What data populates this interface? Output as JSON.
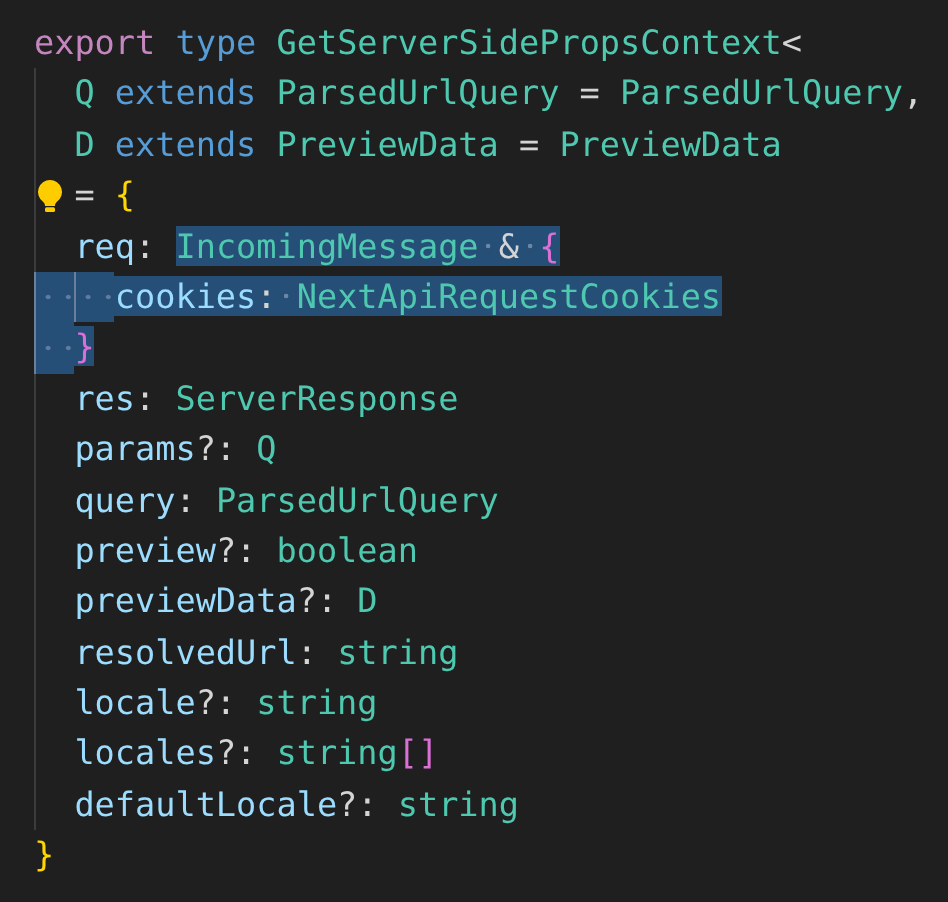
{
  "editor": {
    "lines": [
      {
        "tokens": [
          {
            "text": "export ",
            "kind": "keyword"
          },
          {
            "text": "type ",
            "kind": "storage"
          },
          {
            "text": "GetServerSidePropsContext",
            "kind": "type"
          },
          {
            "text": "<",
            "kind": "punct"
          }
        ],
        "children": [
          {
            "tokens": [
              {
                "text": "Q ",
                "kind": "type"
              },
              {
                "text": "extends ",
                "kind": "storage"
              },
              {
                "text": "ParsedUrlQuery",
                "kind": "type"
              },
              {
                "text": " = ",
                "kind": "punct"
              },
              {
                "text": "ParsedUrlQuery",
                "kind": "type"
              },
              {
                "text": ",",
                "kind": "punct"
              }
            ]
          },
          {
            "tokens": [
              {
                "text": "D ",
                "kind": "type"
              },
              {
                "text": "extends ",
                "kind": "storage"
              },
              {
                "text": "PreviewData",
                "kind": "type"
              },
              {
                "text": " = ",
                "kind": "punct"
              },
              {
                "text": "PreviewData",
                "kind": "type"
              }
            ]
          },
          {
            "lightbulb": true,
            "tokens": [
              {
                "text": "= ",
                "kind": "punct"
              },
              {
                "text": "{",
                "kind": "bracket1"
              }
            ]
          },
          {
            "tokens": [
              {
                "text": "req",
                "kind": "property"
              },
              {
                "text": ": ",
                "kind": "punct"
              },
              {
                "text": "IncomingMessage",
                "kind": "type",
                "selected": true
              },
              {
                "text": " & ",
                "kind": "punct",
                "selected": true
              },
              {
                "text": "{",
                "kind": "bracket2",
                "selected": true
              }
            ],
            "children": [
              {
                "selected": true,
                "tokens": [
                  {
                    "text": "cookies",
                    "kind": "property",
                    "selected": true
                  },
                  {
                    "text": ": ",
                    "kind": "punct",
                    "selected": true
                  },
                  {
                    "text": "NextApiRequestCookies",
                    "kind": "type",
                    "selected": true
                  }
                ]
              }
            ]
          },
          {
            "selected": true,
            "tokens": [
              {
                "text": "}",
                "kind": "bracket2",
                "selected": true
              }
            ]
          },
          {
            "tokens": [
              {
                "text": "res",
                "kind": "property"
              },
              {
                "text": ": ",
                "kind": "punct"
              },
              {
                "text": "ServerResponse",
                "kind": "type"
              }
            ]
          },
          {
            "tokens": [
              {
                "text": "params",
                "kind": "property"
              },
              {
                "text": "?: ",
                "kind": "punct"
              },
              {
                "text": "Q",
                "kind": "type"
              }
            ]
          },
          {
            "tokens": [
              {
                "text": "query",
                "kind": "property"
              },
              {
                "text": ": ",
                "kind": "punct"
              },
              {
                "text": "ParsedUrlQuery",
                "kind": "type"
              }
            ]
          },
          {
            "tokens": [
              {
                "text": "preview",
                "kind": "property"
              },
              {
                "text": "?: ",
                "kind": "punct"
              },
              {
                "text": "boolean",
                "kind": "type"
              }
            ]
          },
          {
            "tokens": [
              {
                "text": "previewData",
                "kind": "property"
              },
              {
                "text": "?: ",
                "kind": "punct"
              },
              {
                "text": "D",
                "kind": "type"
              }
            ]
          },
          {
            "tokens": [
              {
                "text": "resolvedUrl",
                "kind": "property"
              },
              {
                "text": ": ",
                "kind": "punct"
              },
              {
                "text": "string",
                "kind": "type"
              }
            ]
          },
          {
            "tokens": [
              {
                "text": "locale",
                "kind": "property"
              },
              {
                "text": "?: ",
                "kind": "punct"
              },
              {
                "text": "string",
                "kind": "type"
              }
            ]
          },
          {
            "tokens": [
              {
                "text": "locales",
                "kind": "property"
              },
              {
                "text": "?: ",
                "kind": "punct"
              },
              {
                "text": "string",
                "kind": "type"
              },
              {
                "text": "[]",
                "kind": "bracket2"
              }
            ]
          },
          {
            "tokens": [
              {
                "text": "defaultLocale",
                "kind": "property"
              },
              {
                "text": "?: ",
                "kind": "punct"
              },
              {
                "text": "string",
                "kind": "type"
              }
            ]
          }
        ]
      },
      {
        "tokens": [
          {
            "text": "}",
            "kind": "bracket1"
          }
        ]
      }
    ]
  }
}
